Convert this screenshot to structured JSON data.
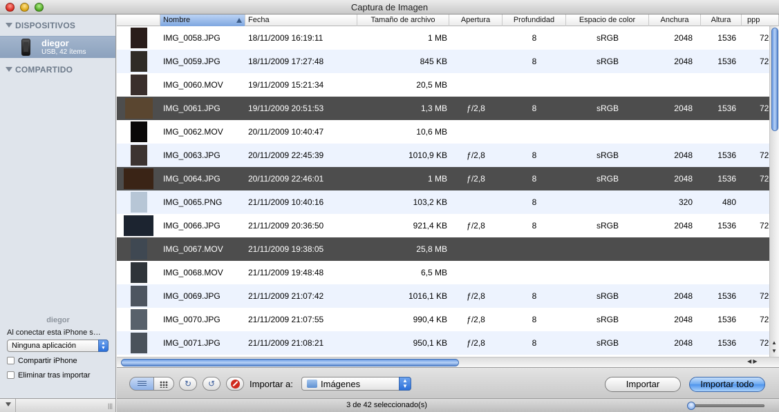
{
  "window": {
    "title": "Captura de Imagen"
  },
  "sidebar": {
    "devices_header": "DISPOSITIVOS",
    "shared_header": "COMPARTIDO",
    "device": {
      "name": "diegor",
      "subtitle": "USB, 42 ítems"
    },
    "bottom": {
      "device_name": "diegor",
      "connect_label": "Al conectar esta iPhone s…",
      "app_popup_value": "Ninguna aplicación",
      "share_checkbox": "Compartir iPhone",
      "delete_checkbox": "Eliminar tras importar"
    }
  },
  "table": {
    "columns": [
      "",
      "Nombre",
      "Fecha",
      "Tamaño de archivo",
      "Apertura",
      "Profundidad",
      "Espacio de color",
      "Anchura",
      "Altura",
      "ppp"
    ],
    "rows": [
      {
        "name": "IMG_0058.JPG",
        "date": "18/11/2009 16:19:11",
        "size": "1 MB",
        "aperture": "",
        "depth": "8",
        "colorspace": "sRGB",
        "width": "2048",
        "height": "1536",
        "ppp": "72",
        "selected": false
      },
      {
        "name": "IMG_0059.JPG",
        "date": "18/11/2009 17:27:48",
        "size": "845 KB",
        "aperture": "",
        "depth": "8",
        "colorspace": "sRGB",
        "width": "2048",
        "height": "1536",
        "ppp": "72",
        "selected": false
      },
      {
        "name": "IMG_0060.MOV",
        "date": "19/11/2009 15:21:34",
        "size": "20,5 MB",
        "aperture": "",
        "depth": "",
        "colorspace": "",
        "width": "",
        "height": "",
        "ppp": "",
        "selected": false
      },
      {
        "name": "IMG_0061.JPG",
        "date": "19/11/2009 20:51:53",
        "size": "1,3 MB",
        "aperture": "ƒ/2,8",
        "depth": "8",
        "colorspace": "sRGB",
        "width": "2048",
        "height": "1536",
        "ppp": "72",
        "selected": true
      },
      {
        "name": "IMG_0062.MOV",
        "date": "20/11/2009 10:40:47",
        "size": "10,6 MB",
        "aperture": "",
        "depth": "",
        "colorspace": "",
        "width": "",
        "height": "",
        "ppp": "",
        "selected": false
      },
      {
        "name": "IMG_0063.JPG",
        "date": "20/11/2009 22:45:39",
        "size": "1010,9 KB",
        "aperture": "ƒ/2,8",
        "depth": "8",
        "colorspace": "sRGB",
        "width": "2048",
        "height": "1536",
        "ppp": "72",
        "selected": false
      },
      {
        "name": "IMG_0064.JPG",
        "date": "20/11/2009 22:46:01",
        "size": "1 MB",
        "aperture": "ƒ/2,8",
        "depth": "8",
        "colorspace": "sRGB",
        "width": "2048",
        "height": "1536",
        "ppp": "72",
        "selected": true
      },
      {
        "name": "IMG_0065.PNG",
        "date": "21/11/2009 10:40:16",
        "size": "103,2 KB",
        "aperture": "",
        "depth": "8",
        "colorspace": "",
        "width": "320",
        "height": "480",
        "ppp": "",
        "selected": false
      },
      {
        "name": "IMG_0066.JPG",
        "date": "21/11/2009 20:36:50",
        "size": "921,4 KB",
        "aperture": "ƒ/2,8",
        "depth": "8",
        "colorspace": "sRGB",
        "width": "2048",
        "height": "1536",
        "ppp": "72",
        "selected": false
      },
      {
        "name": "IMG_0067.MOV",
        "date": "21/11/2009 19:38:05",
        "size": "25,8 MB",
        "aperture": "",
        "depth": "",
        "colorspace": "",
        "width": "",
        "height": "",
        "ppp": "",
        "selected": true
      },
      {
        "name": "IMG_0068.MOV",
        "date": "21/11/2009 19:48:48",
        "size": "6,5 MB",
        "aperture": "",
        "depth": "",
        "colorspace": "",
        "width": "",
        "height": "",
        "ppp": "",
        "selected": false
      },
      {
        "name": "IMG_0069.JPG",
        "date": "21/11/2009 21:07:42",
        "size": "1016,1 KB",
        "aperture": "ƒ/2,8",
        "depth": "8",
        "colorspace": "sRGB",
        "width": "2048",
        "height": "1536",
        "ppp": "72",
        "selected": false
      },
      {
        "name": "IMG_0070.JPG",
        "date": "21/11/2009 21:07:55",
        "size": "990,4 KB",
        "aperture": "ƒ/2,8",
        "depth": "8",
        "colorspace": "sRGB",
        "width": "2048",
        "height": "1536",
        "ppp": "72",
        "selected": false
      },
      {
        "name": "IMG_0071.JPG",
        "date": "21/11/2009 21:08:21",
        "size": "950,1 KB",
        "aperture": "ƒ/2,8",
        "depth": "8",
        "colorspace": "sRGB",
        "width": "2048",
        "height": "1536",
        "ppp": "72",
        "selected": false
      }
    ]
  },
  "toolbar": {
    "import_to_label": "Importar a:",
    "destination_value": "Imágenes",
    "import_button": "Importar",
    "import_all_button": "Importar todo",
    "icons": [
      "list-view-icon",
      "icon-view-icon",
      "rotate-left-icon",
      "rotate-right-icon",
      "delete-icon",
      "folder-icon"
    ]
  },
  "status": {
    "text": "3 de 42 seleccionado(s)",
    "zoom_fraction": 0.0
  },
  "colors": {
    "selection": "#4d4d4d",
    "alt_row": "#edf3fe",
    "accent": "#4e94ec"
  }
}
